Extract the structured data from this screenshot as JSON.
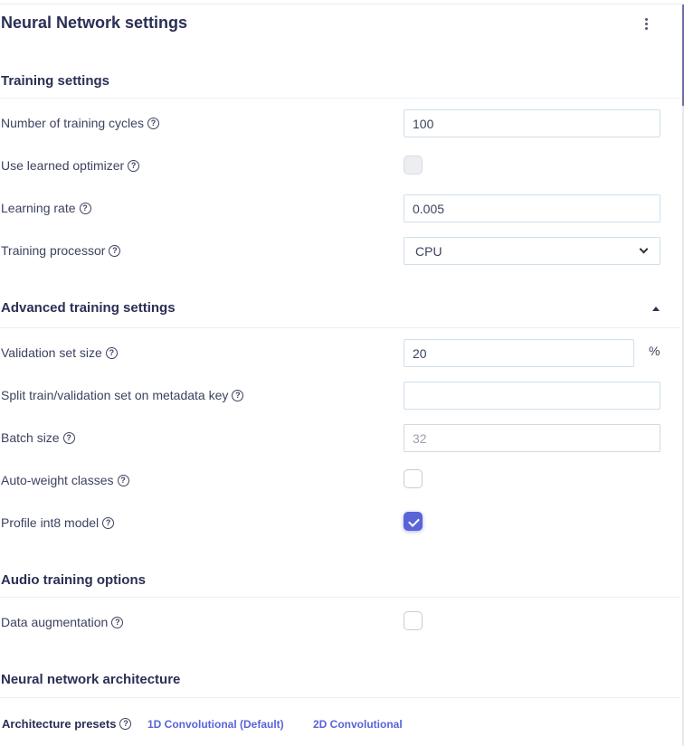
{
  "panel": {
    "title": "Neural Network settings",
    "menu_icon": "kebab-menu-icon"
  },
  "sections": {
    "training": "Training settings",
    "advanced": "Advanced training settings",
    "audio": "Audio training options",
    "architecture": "Neural network architecture"
  },
  "training": {
    "cycles": {
      "label": "Number of training cycles",
      "value": "100"
    },
    "learned_optimizer": {
      "label": "Use learned optimizer",
      "checked": false,
      "disabled": true
    },
    "learning_rate": {
      "label": "Learning rate",
      "value": "0.005"
    },
    "processor": {
      "label": "Training processor",
      "value": "CPU"
    }
  },
  "advanced": {
    "validation": {
      "label": "Validation set size",
      "value": "20",
      "unit": "%"
    },
    "split_key": {
      "label": "Split train/validation set on metadata key",
      "value": ""
    },
    "batch": {
      "label": "Batch size",
      "placeholder": "32"
    },
    "auto_weight": {
      "label": "Auto-weight classes",
      "checked": false
    },
    "profile_int8": {
      "label": "Profile int8 model",
      "checked": true
    }
  },
  "audio": {
    "augmentation": {
      "label": "Data augmentation",
      "checked": false
    }
  },
  "architecture": {
    "presets_label": "Architecture presets",
    "presets": [
      "1D Convolutional (Default)",
      "2D Convolutional"
    ]
  },
  "help_glyph": "?",
  "colors": {
    "accent": "#5a63d8",
    "title": "#2a2f55",
    "text": "#3d4260",
    "input_border": "#cfe0ec"
  }
}
